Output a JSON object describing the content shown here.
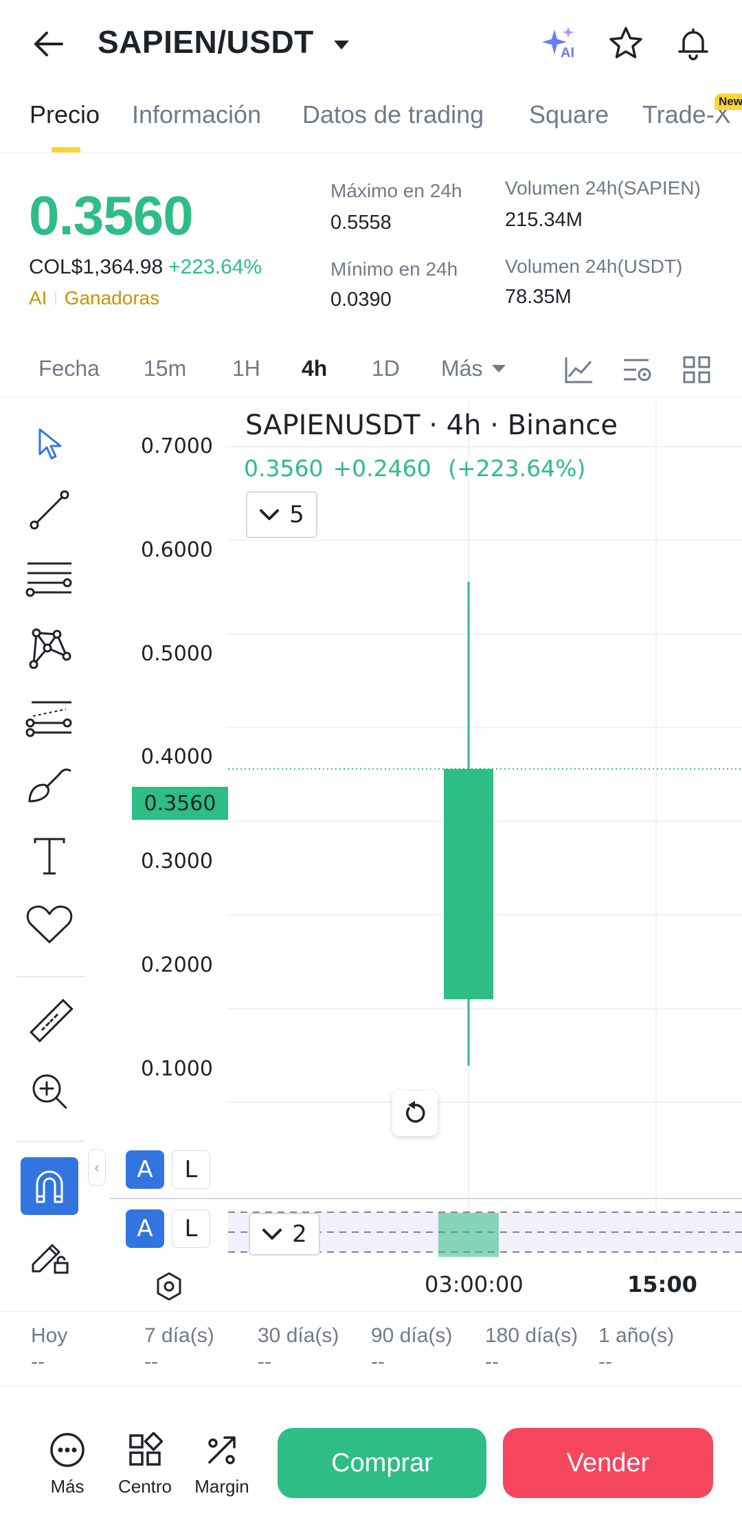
{
  "header": {
    "pair": "SAPIEN/USDT",
    "ai_label": "AI",
    "icons": [
      "back-arrow-icon",
      "caret-down-icon",
      "ai-sparkle-icon",
      "star-icon",
      "bell-icon"
    ]
  },
  "tabs": [
    {
      "label": "Precio",
      "active": true
    },
    {
      "label": "Información",
      "active": false
    },
    {
      "label": "Datos de trading",
      "active": false
    },
    {
      "label": "Square",
      "active": false
    },
    {
      "label": "Trade-X",
      "active": false
    }
  ],
  "new_badge": "New",
  "stats": {
    "price": "0.3560",
    "fiat": "COL$1,364.98",
    "change": "+223.64%",
    "tag_ai": "AI",
    "tag_gainers": "Ganadoras",
    "high_label": "Máximo en 24h",
    "high_value": "0.5558",
    "low_label": "Mínimo en 24h",
    "low_value": "0.0390",
    "vol_base_label": "Volumen 24h(SAPIEN)",
    "vol_base_value": "215.34M",
    "vol_quote_label": "Volumen 24h(USDT)",
    "vol_quote_value": "78.35M"
  },
  "intervals": {
    "items": [
      "Fecha",
      "15m",
      "1H",
      "4h",
      "1D",
      "Más"
    ],
    "active": "4h"
  },
  "chart": {
    "title": "SAPIENUSDT · 4h · Binance",
    "last": "0.3560",
    "change_abs": "+0.2460",
    "change_pct": "(+223.64%)",
    "indicators_count": "5",
    "volume_pane_count": "2",
    "price_tag": "0.3560",
    "y_labels": [
      "0.7000",
      "0.6000",
      "0.5000",
      "0.4000",
      "0.3000",
      "0.2000",
      "0.1000"
    ],
    "time_labels": [
      "03:00:00",
      "15:00"
    ],
    "btn_a": "A",
    "btn_l": "L",
    "colors": {
      "up": "#2ebd85",
      "down": "#f6465d"
    }
  },
  "chart_data": {
    "type": "candlestick",
    "title": "SAPIENUSDT · 4h · Binance",
    "ylim": [
      0.0,
      0.7
    ],
    "candles": [
      {
        "time": "03:00:00",
        "open": 0.11,
        "high": 0.5558,
        "low": 0.039,
        "close": 0.356
      }
    ],
    "last_price": 0.356
  },
  "performance": [
    {
      "label": "Hoy",
      "value": "--"
    },
    {
      "label": "7 día(s)",
      "value": "--"
    },
    {
      "label": "30 día(s)",
      "value": "--"
    },
    {
      "label": "90 día(s)",
      "value": "--"
    },
    {
      "label": "180 día(s)",
      "value": "--"
    },
    {
      "label": "1 año(s)",
      "value": "--"
    }
  ],
  "bottom_bar": {
    "more": "Más",
    "center": "Centro",
    "margin": "Margin",
    "buy": "Comprar",
    "sell": "Vender"
  }
}
